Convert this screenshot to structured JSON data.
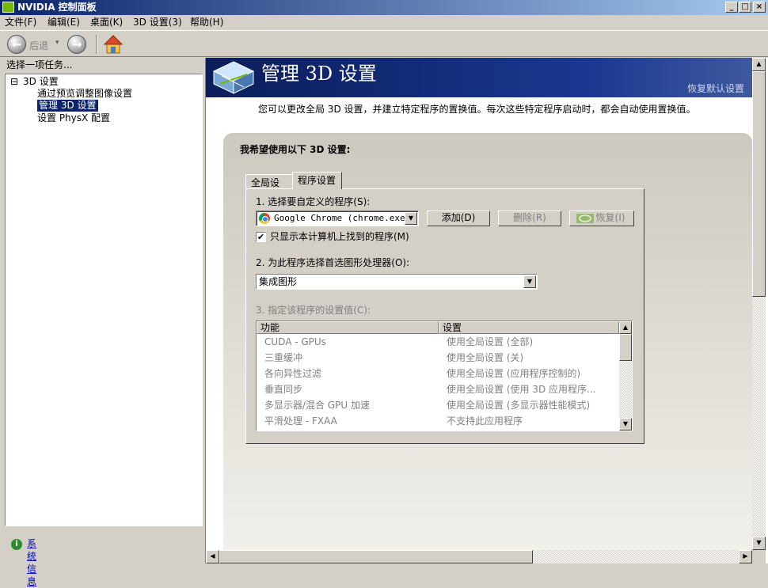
{
  "window": {
    "title": "NVIDIA 控制面板",
    "minimize": "_",
    "maximize": "□",
    "close": "×"
  },
  "menu": [
    "文件(F)",
    "编辑(E)",
    "桌面(K)",
    "3D 设置(3)",
    "帮助(H)"
  ],
  "toolbar": {
    "back_label": "后退",
    "back_glyph": "←",
    "forward_glyph": "→",
    "dropdown_glyph": "▾"
  },
  "left_pane": {
    "header": "选择一项任务...",
    "tree": {
      "root_toggle": "⊟",
      "root": "3D 设置",
      "children": [
        "通过预览调整图像设置",
        "管理 3D 设置",
        "设置 PhysX 配置"
      ],
      "selected_index": 1
    },
    "system_info": "系统信息"
  },
  "banner": {
    "title": "管理 3D 设置",
    "restore_defaults": "恢复默认设置"
  },
  "description": "您可以更改全局 3D 设置，并建立特定程序的置换值。每次这些特定程序启动时，都会自动使用置换值。",
  "settings_box": {
    "title": "我希望使用以下 3D 设置:",
    "tabs": [
      "全局设置",
      "程序设置"
    ],
    "active_tab": 1,
    "step1": {
      "label": "1. 选择要自定义的程序(S):",
      "program": "Google Chrome (chrome.exe)",
      "add": "添加(D)",
      "remove": "删除(R)",
      "restore": "恢复(I)",
      "checkbox_label": "只显示本计算机上找到的程序(M)",
      "checkbox_checked": true
    },
    "step2": {
      "label": "2. 为此程序选择首选图形处理器(O):",
      "value": "集成图形"
    },
    "step3": {
      "label": "3. 指定该程序的设置值(C):",
      "columns": [
        "功能",
        "设置"
      ],
      "rows": [
        {
          "feature": "CUDA - GPUs",
          "setting": "使用全局设置 (全部)"
        },
        {
          "feature": "三重缓冲",
          "setting": "使用全局设置 (关)"
        },
        {
          "feature": "各向异性过滤",
          "setting": "使用全局设置 (应用程序控制的)"
        },
        {
          "feature": "垂直同步",
          "setting": "使用全局设置 (使用 3D 应用程序..."
        },
        {
          "feature": "多显示器/混合 GPU 加速",
          "setting": "使用全局设置 (多显示器性能模式)"
        },
        {
          "feature": "平滑处理 - FXAA",
          "setting": "不支持此应用程序"
        }
      ]
    }
  },
  "glyphs": {
    "dropdown": "▼",
    "up": "▲",
    "down": "▼",
    "left": "◀",
    "right": "▶",
    "check": "✔",
    "info": "i"
  },
  "colors": {
    "titlebar_start": "#0a246a",
    "selection": "#0a246a",
    "nvidia_green": "#76b900",
    "banner": "#1a3890"
  }
}
